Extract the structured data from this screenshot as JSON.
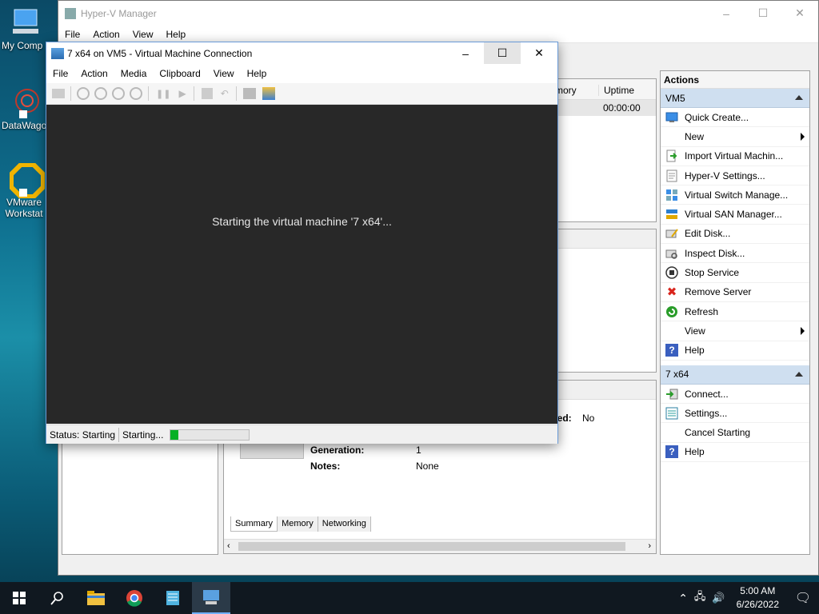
{
  "desktop": {
    "icons": [
      {
        "label": "My Comp"
      },
      {
        "label": "DataWago"
      },
      {
        "label": "VMware Workstat"
      }
    ]
  },
  "hyperv": {
    "title": "Hyper-V Manager",
    "menu": [
      "File",
      "Action",
      "View",
      "Help"
    ],
    "vm_list": {
      "col_memory": "mory",
      "col_uptime": "Uptime",
      "uptime_value": "00:00:00"
    },
    "details": {
      "partial_label": "red:",
      "partial_value": "No",
      "generation_label": "Generation:",
      "generation_value": "1",
      "notes_label": "Notes:",
      "notes_value": "None",
      "tabs": [
        "Summary",
        "Memory",
        "Networking"
      ]
    }
  },
  "actions": {
    "header": "Actions",
    "groups": [
      {
        "name": "VM5",
        "items": [
          {
            "label": "Quick Create...",
            "icon": "quick-create-icon"
          },
          {
            "label": "New",
            "icon": "",
            "submenu": true
          },
          {
            "label": "Import Virtual Machin...",
            "icon": "import-icon"
          },
          {
            "label": "Hyper-V Settings...",
            "icon": "settings-doc-icon"
          },
          {
            "label": "Virtual Switch Manage...",
            "icon": "switch-icon"
          },
          {
            "label": "Virtual SAN Manager...",
            "icon": "san-icon"
          },
          {
            "label": "Edit Disk...",
            "icon": "edit-disk-icon"
          },
          {
            "label": "Inspect Disk...",
            "icon": "inspect-disk-icon"
          },
          {
            "label": "Stop Service",
            "icon": "stop-icon"
          },
          {
            "label": "Remove Server",
            "icon": "remove-icon"
          },
          {
            "label": "Refresh",
            "icon": "refresh-icon"
          },
          {
            "label": "View",
            "icon": "",
            "submenu": true
          },
          {
            "label": "Help",
            "icon": "help-icon"
          }
        ]
      },
      {
        "name": "7 x64",
        "items": [
          {
            "label": "Connect...",
            "icon": "connect-icon"
          },
          {
            "label": "Settings...",
            "icon": "settings-icon"
          },
          {
            "label": "Cancel Starting",
            "icon": ""
          },
          {
            "label": "Help",
            "icon": "help-icon"
          }
        ]
      }
    ]
  },
  "vmconnect": {
    "title": "7 x64 on VM5 - Virtual Machine Connection",
    "menu": [
      "File",
      "Action",
      "Media",
      "Clipboard",
      "View",
      "Help"
    ],
    "screen_message": "Starting the virtual machine '7 x64'...",
    "status_label": "Status: Starting",
    "progress_label": "Starting...",
    "progress_fraction": 0.1
  },
  "taskbar": {
    "time": "5:00 AM",
    "date": "6/26/2022"
  },
  "colors": {
    "accent": "#0078d7",
    "progress": "#06b025",
    "vm_screen": "#282828"
  }
}
